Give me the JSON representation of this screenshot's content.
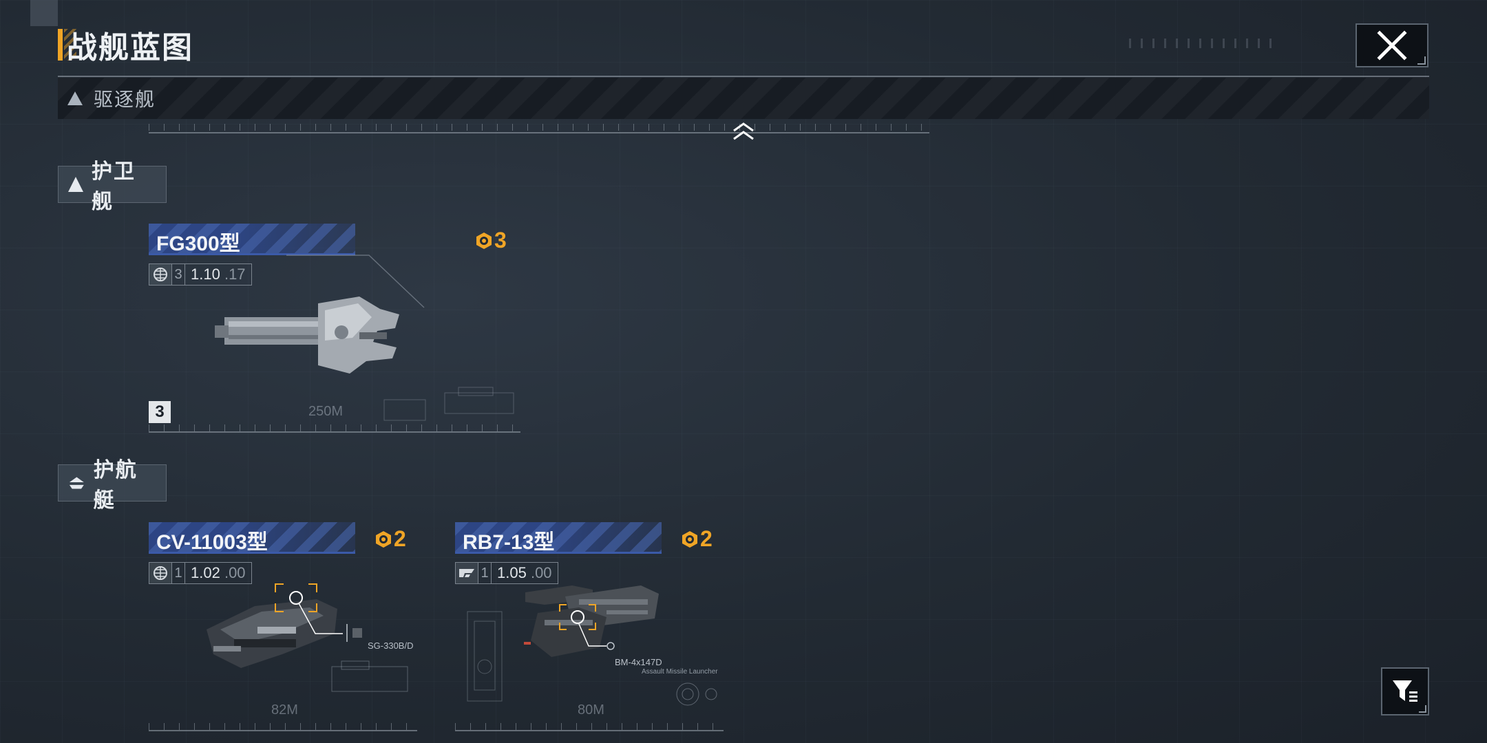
{
  "header": {
    "title": "战舰蓝图",
    "close_icon": "close-icon"
  },
  "categories": {
    "destroyer": {
      "label": "驱逐舰",
      "state": "collapsed"
    },
    "frigate": {
      "label": "护卫舰"
    },
    "escort": {
      "label": "护航艇"
    }
  },
  "ships": {
    "fg300": {
      "name": "FG300型",
      "cost": "3",
      "tier": "3",
      "version_main": "1.10",
      "version_sub": "17",
      "size": "250M",
      "badge": "3",
      "faction_icon": "globe-icon"
    },
    "cv11003": {
      "name": "CV-11003型",
      "cost": "2",
      "tier": "1",
      "version_main": "1.02",
      "version_sub": "00",
      "size": "82M",
      "weapon": "SG-330B/D",
      "faction_icon": "globe-icon"
    },
    "rb713": {
      "name": "RB7-13型",
      "cost": "2",
      "tier": "1",
      "version_main": "1.05",
      "version_sub": "00",
      "size": "80M",
      "weapon": "BM-4x147D",
      "weapon_desc": "Assault Missile Launcher",
      "faction_icon": "faction-emblem-icon"
    }
  },
  "accent_colors": {
    "orange": "#f0a526",
    "blue": "#2d4584",
    "panel": "#171c23"
  },
  "filter_icon": "filter-icon"
}
